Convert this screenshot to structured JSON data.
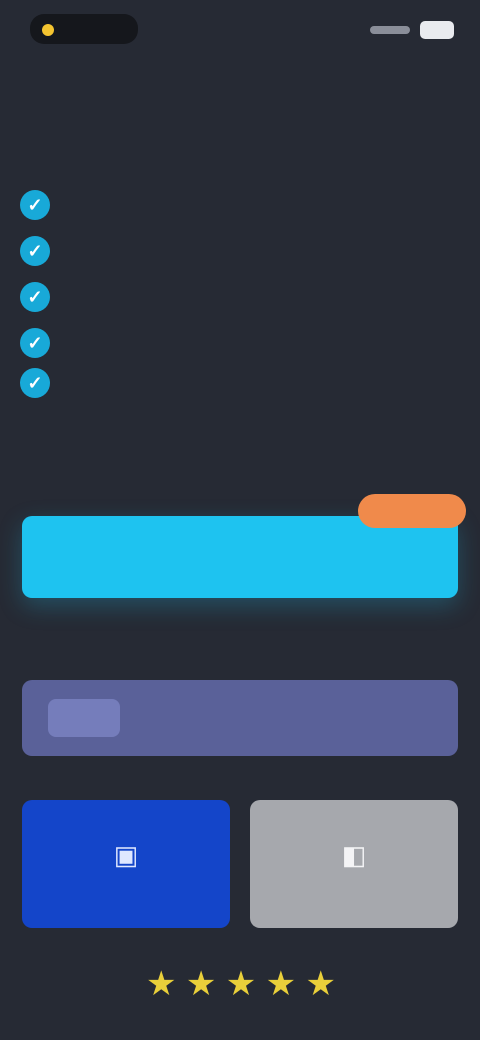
{
  "status_bar": {
    "signal_icon": "signal-icon",
    "battery_icon": "battery-icon",
    "indicator_color": "#f4c430"
  },
  "headline": "",
  "features": [
    {
      "icon": "check-icon",
      "text": ""
    },
    {
      "icon": "check-icon",
      "text": ""
    },
    {
      "icon": "check-icon",
      "text": ""
    },
    {
      "icon": "check-icon",
      "text": ""
    },
    {
      "icon": "check-icon",
      "text": ""
    }
  ],
  "offer": {
    "badge": "",
    "cta_label": "",
    "cta_subtext": "",
    "accent_color": "#1ec3f0",
    "badge_color": "#f08a4b"
  },
  "alt_plan": {
    "badge": "",
    "label": "",
    "color": "#5a6199"
  },
  "payment_options": [
    {
      "icon": "card-icon",
      "label": "",
      "color": "#1445c9"
    },
    {
      "icon": "wallet-icon",
      "label": "",
      "color": "#a6a8ad"
    }
  ],
  "rating": {
    "stars": 5,
    "star_icon": "star-icon",
    "star_color": "#e9cf3a",
    "review_text": ""
  }
}
